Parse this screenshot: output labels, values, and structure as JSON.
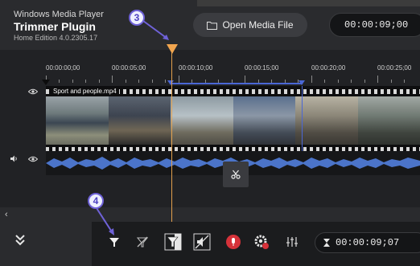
{
  "header": {
    "app_name": "Windows Media Player",
    "plugin_title": "Trimmer Plugin",
    "edition": "Home Edition 4.0.2305.17",
    "open_button_label": "Open Media File",
    "current_time": "00:00:09;00"
  },
  "ruler": {
    "labels": [
      "00:00:00;00",
      "00:00:05;00",
      "00:00:10;00",
      "00:00:15;00",
      "00:00:20;00",
      "00:00:25;00"
    ]
  },
  "video_track": {
    "clip_name": "Sport and people.mp4",
    "visibility_icon": "eye-icon"
  },
  "audio_track": {
    "mute_icon": "speaker-icon",
    "visibility_icon": "eye-icon"
  },
  "annotations": {
    "badge_3": "3",
    "badge_4": "4"
  },
  "toolbar": {
    "icons": [
      "collapse-icon",
      "marker-in-icon",
      "marker-clear-icon",
      "trim-filter-icon",
      "mute-segment-icon",
      "record-icon",
      "settings-icon",
      "equalizer-icon"
    ],
    "bottom_time": "00:00:09;07"
  },
  "colors": {
    "playhead": "#f2a64f",
    "selection": "#4a67d6",
    "audio_wave": "#4b74c9",
    "badge_border": "#6f62d8"
  }
}
